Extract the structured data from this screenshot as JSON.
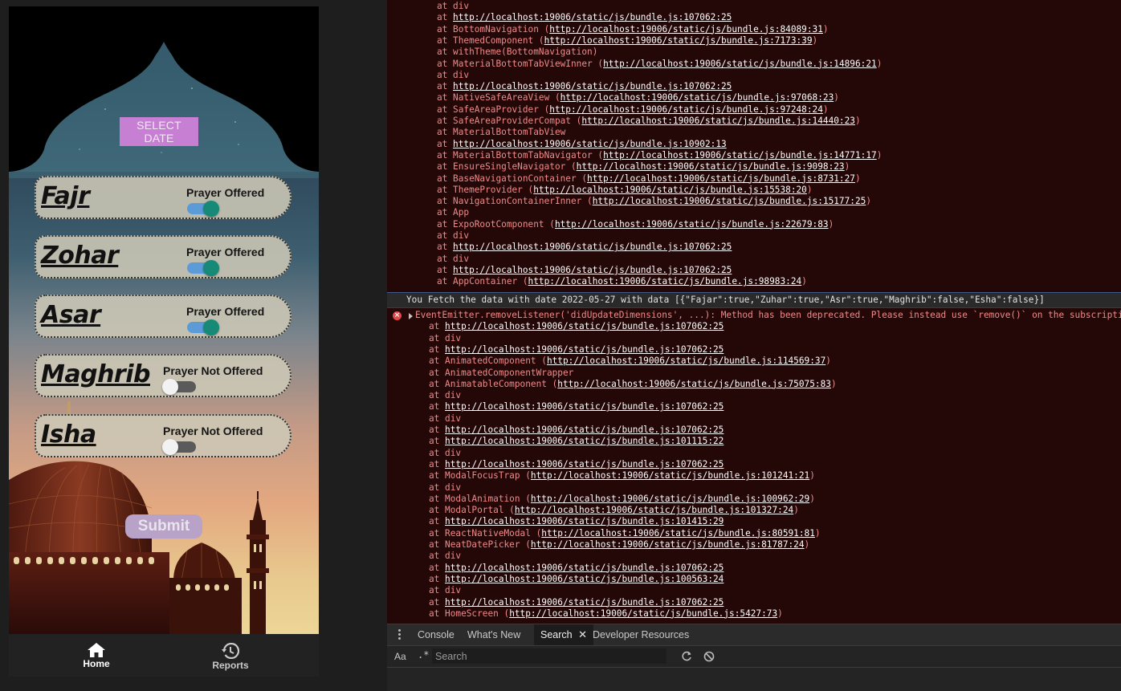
{
  "app": {
    "select_date_label": "SELECT DATE",
    "prayers": [
      {
        "name": "Fajr",
        "status": "Prayer Offered",
        "offered": true
      },
      {
        "name": "Zohar",
        "status": "Prayer Offered",
        "offered": true
      },
      {
        "name": "Asar",
        "status": "Prayer Offered",
        "offered": true
      },
      {
        "name": "Maghrib",
        "status": "Prayer Not Offered",
        "offered": false
      },
      {
        "name": "Isha",
        "status": "Prayer Not Offered",
        "offered": false
      }
    ],
    "submit_label": "Submit",
    "tabs": [
      {
        "label": "Home",
        "icon": "home-icon",
        "active": true
      },
      {
        "label": "Reports",
        "icon": "history-icon",
        "active": false
      }
    ],
    "colors": {
      "select_date": "#c67fd3",
      "toggle_on": "#168a77",
      "submit": "#b8a2c8"
    }
  },
  "console": {
    "stack_top": [
      {
        "text": "at div"
      },
      {
        "text": "at ",
        "url": "http://localhost:19006/static/js/bundle.js:107062:25"
      },
      {
        "text": "at BottomNavigation (",
        "url": "http://localhost:19006/static/js/bundle.js:84089:31",
        "tail": ")"
      },
      {
        "text": "at ThemedComponent (",
        "url": "http://localhost:19006/static/js/bundle.js:7173:39",
        "tail": ")"
      },
      {
        "text": "at withTheme(BottomNavigation)"
      },
      {
        "text": "at MaterialBottomTabViewInner (",
        "url": "http://localhost:19006/static/js/bundle.js:14896:21",
        "tail": ")"
      },
      {
        "text": "at div"
      },
      {
        "text": "at ",
        "url": "http://localhost:19006/static/js/bundle.js:107062:25"
      },
      {
        "text": "at NativeSafeAreaView (",
        "url": "http://localhost:19006/static/js/bundle.js:97068:23",
        "tail": ")"
      },
      {
        "text": "at SafeAreaProvider (",
        "url": "http://localhost:19006/static/js/bundle.js:97248:24",
        "tail": ")"
      },
      {
        "text": "at SafeAreaProviderCompat (",
        "url": "http://localhost:19006/static/js/bundle.js:14440:23",
        "tail": ")"
      },
      {
        "text": "at MaterialBottomTabView"
      },
      {
        "text": "at ",
        "url": "http://localhost:19006/static/js/bundle.js:10902:13"
      },
      {
        "text": "at MaterialBottomTabNavigator (",
        "url": "http://localhost:19006/static/js/bundle.js:14771:17",
        "tail": ")"
      },
      {
        "text": "at EnsureSingleNavigator (",
        "url": "http://localhost:19006/static/js/bundle.js:9098:23",
        "tail": ")"
      },
      {
        "text": "at BaseNavigationContainer (",
        "url": "http://localhost:19006/static/js/bundle.js:8731:27",
        "tail": ")"
      },
      {
        "text": "at ThemeProvider (",
        "url": "http://localhost:19006/static/js/bundle.js:15538:20",
        "tail": ")"
      },
      {
        "text": "at NavigationContainerInner (",
        "url": "http://localhost:19006/static/js/bundle.js:15177:25",
        "tail": ")"
      },
      {
        "text": "at App"
      },
      {
        "text": "at ExpoRootComponent (",
        "url": "http://localhost:19006/static/js/bundle.js:22679:83",
        "tail": ")"
      },
      {
        "text": "at div"
      },
      {
        "text": "at ",
        "url": "http://localhost:19006/static/js/bundle.js:107062:25"
      },
      {
        "text": "at div"
      },
      {
        "text": "at ",
        "url": "http://localhost:19006/static/js/bundle.js:107062:25"
      },
      {
        "text": "at AppContainer (",
        "url": "http://localhost:19006/static/js/bundle.js:98983:24",
        "tail": ")"
      }
    ],
    "log_message": "You Fetch the data with date  2022-05-27  with data  [{\"Fajar\":true,\"Zuhar\":true,\"Asr\":true,\"Maghrib\":false,\"Esha\":false}]",
    "error_message": "EventEmitter.removeListener('didUpdateDimensions', ...): Method has been deprecated. Please instead use `remove()` on the subscription",
    "stack_error": [
      {
        "text": "at ",
        "url": "http://localhost:19006/static/js/bundle.js:107062:25"
      },
      {
        "text": "at div"
      },
      {
        "text": "at ",
        "url": "http://localhost:19006/static/js/bundle.js:107062:25"
      },
      {
        "text": "at AnimatedComponent (",
        "url": "http://localhost:19006/static/js/bundle.js:114569:37",
        "tail": ")"
      },
      {
        "text": "at AnimatedComponentWrapper"
      },
      {
        "text": "at AnimatableComponent (",
        "url": "http://localhost:19006/static/js/bundle.js:75075:83",
        "tail": ")"
      },
      {
        "text": "at div"
      },
      {
        "text": "at ",
        "url": "http://localhost:19006/static/js/bundle.js:107062:25"
      },
      {
        "text": "at div"
      },
      {
        "text": "at ",
        "url": "http://localhost:19006/static/js/bundle.js:107062:25"
      },
      {
        "text": "at ",
        "url": "http://localhost:19006/static/js/bundle.js:101115:22"
      },
      {
        "text": "at div"
      },
      {
        "text": "at ",
        "url": "http://localhost:19006/static/js/bundle.js:107062:25"
      },
      {
        "text": "at ModalFocusTrap (",
        "url": "http://localhost:19006/static/js/bundle.js:101241:21",
        "tail": ")"
      },
      {
        "text": "at div"
      },
      {
        "text": "at ModalAnimation (",
        "url": "http://localhost:19006/static/js/bundle.js:100962:29",
        "tail": ")"
      },
      {
        "text": "at ModalPortal (",
        "url": "http://localhost:19006/static/js/bundle.js:101327:24",
        "tail": ")"
      },
      {
        "text": "at ",
        "url": "http://localhost:19006/static/js/bundle.js:101415:29"
      },
      {
        "text": "at ReactNativeModal (",
        "url": "http://localhost:19006/static/js/bundle.js:80591:81",
        "tail": ")"
      },
      {
        "text": "at NeatDatePicker (",
        "url": "http://localhost:19006/static/js/bundle.js:81787:24",
        "tail": ")"
      },
      {
        "text": "at div"
      },
      {
        "text": "at ",
        "url": "http://localhost:19006/static/js/bundle.js:107062:25"
      },
      {
        "text": "at ",
        "url": "http://localhost:19006/static/js/bundle.js:100563:24"
      },
      {
        "text": "at div"
      },
      {
        "text": "at ",
        "url": "http://localhost:19006/static/js/bundle.js:107062:25"
      },
      {
        "text": "at HomeScreen (",
        "url": "http://localhost:19006/static/js/bundle.js:5427:73",
        "tail": ")"
      }
    ]
  },
  "drawer": {
    "tabs": [
      {
        "label": "Console",
        "active": false
      },
      {
        "label": "What's New",
        "active": false
      },
      {
        "label": "Search",
        "active": true,
        "closable": true
      },
      {
        "label": "Developer Resources",
        "active": false
      }
    ],
    "search": {
      "match_case_label": "Aa",
      "regex_label": ".*",
      "placeholder": "Search"
    }
  }
}
